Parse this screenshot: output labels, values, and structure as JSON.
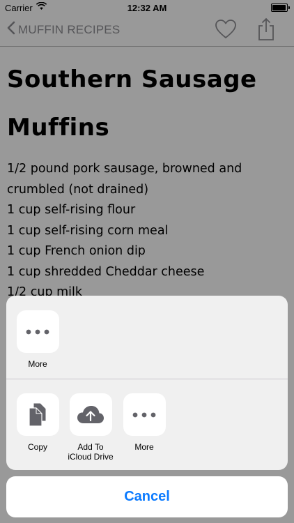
{
  "status_bar": {
    "carrier": "Carrier",
    "time": "12:32 AM"
  },
  "nav": {
    "back_label": "MUFFIN RECIPES"
  },
  "recipe": {
    "title_line1": "Southern Sausage",
    "title_line2": "Muffins",
    "ingredients": [
      "1/2 pound pork sausage, browned and",
      "crumbled (not drained)",
      "1 cup self-rising flour",
      "1 cup self-rising corn meal",
      "1 cup French onion dip",
      "1 cup shredded Cheddar cheese",
      "1/2 cup milk"
    ]
  },
  "share_sheet": {
    "row1": [
      {
        "label": "More",
        "icon": "more-icon"
      }
    ],
    "row2": [
      {
        "label": "Copy",
        "icon": "copy-icon"
      },
      {
        "label_line1": "Add To",
        "label_line2": "iCloud Drive",
        "icon": "icloud-upload-icon"
      },
      {
        "label": "More",
        "icon": "more-icon"
      }
    ],
    "cancel_label": "Cancel"
  },
  "colors": {
    "accent": "#0a7aff",
    "nav_gray": "#8e8e93",
    "icon_gray": "#636369"
  }
}
